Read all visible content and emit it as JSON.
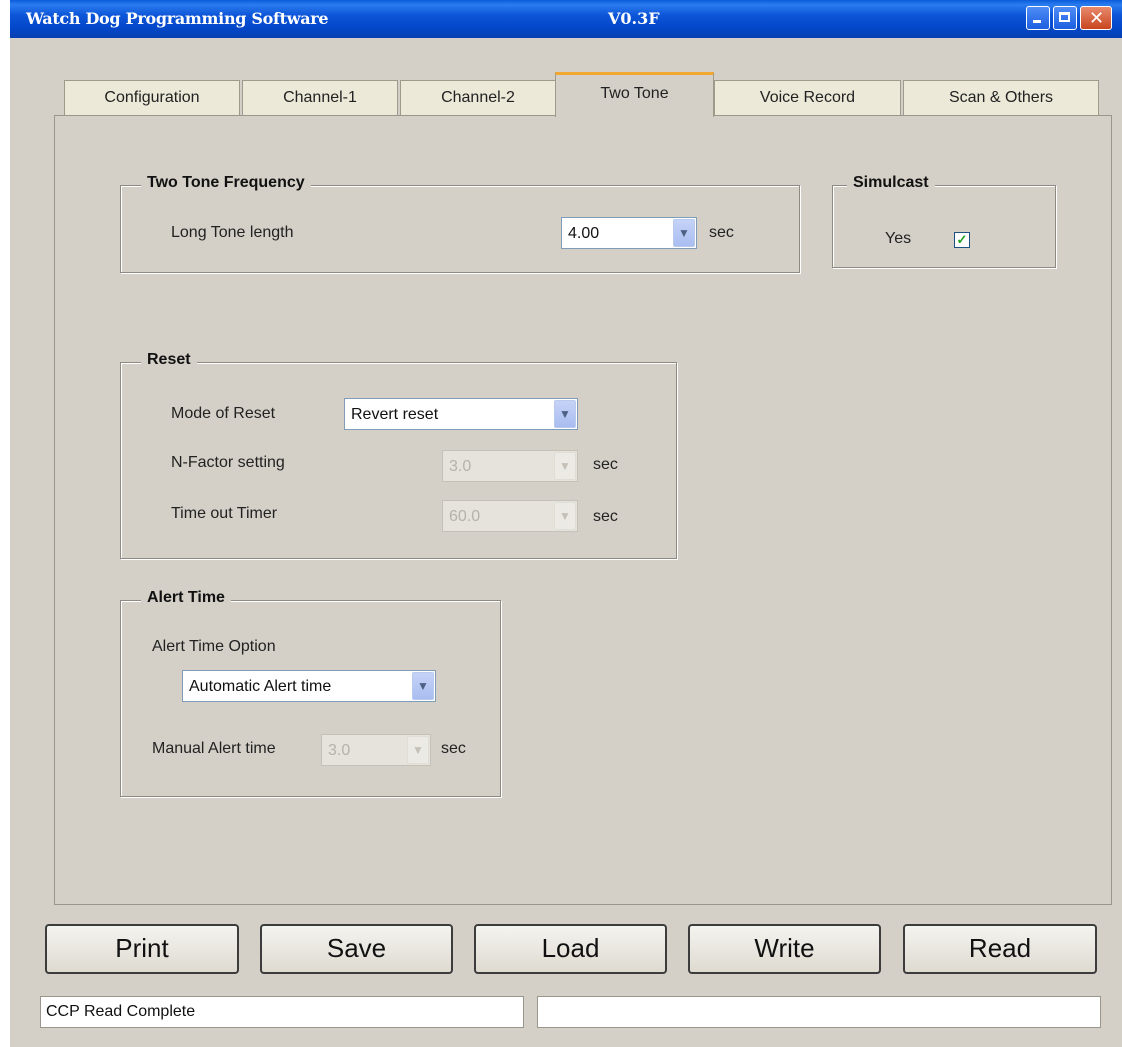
{
  "window": {
    "title": "Watch Dog Programming Software",
    "version": "V0.3F"
  },
  "tabs": [
    {
      "label": "Configuration"
    },
    {
      "label": "Channel-1"
    },
    {
      "label": "Channel-2"
    },
    {
      "label": "Two Tone",
      "active": true
    },
    {
      "label": "Voice Record"
    },
    {
      "label": "Scan & Others"
    }
  ],
  "two_tone_frequency": {
    "legend": "Two Tone Frequency",
    "long_tone_label": "Long Tone length",
    "long_tone_value": "4.00",
    "unit": "sec"
  },
  "simulcast": {
    "legend": "Simulcast",
    "yes_label": "Yes",
    "checked": true
  },
  "reset": {
    "legend": "Reset",
    "mode_label": "Mode of Reset",
    "mode_value": "Revert reset",
    "nfactor_label": "N-Factor setting",
    "nfactor_value": "3.0",
    "nfactor_unit": "sec",
    "timeout_label": "Time out Timer",
    "timeout_value": "60.0",
    "timeout_unit": "sec"
  },
  "alert_time": {
    "legend": "Alert Time",
    "option_label": "Alert Time Option",
    "option_value": "Automatic Alert time",
    "manual_label": "Manual Alert time",
    "manual_value": "3.0",
    "manual_unit": "sec"
  },
  "buttons": {
    "print": "Print",
    "save": "Save",
    "load": "Load",
    "write": "Write",
    "read": "Read"
  },
  "status": {
    "message": "CCP Read Complete",
    "secondary": ""
  },
  "icons": {
    "minimize": "minimize-icon",
    "maximize": "maximize-icon",
    "close": "close-icon",
    "dropdown": "chevron-down-icon",
    "check": "checkmark-icon"
  },
  "colors": {
    "titlebar": "#0347c9",
    "window_bg": "#d4d0c8",
    "active_tab_accent": "#f0a830",
    "checkmark": "#21a121"
  }
}
